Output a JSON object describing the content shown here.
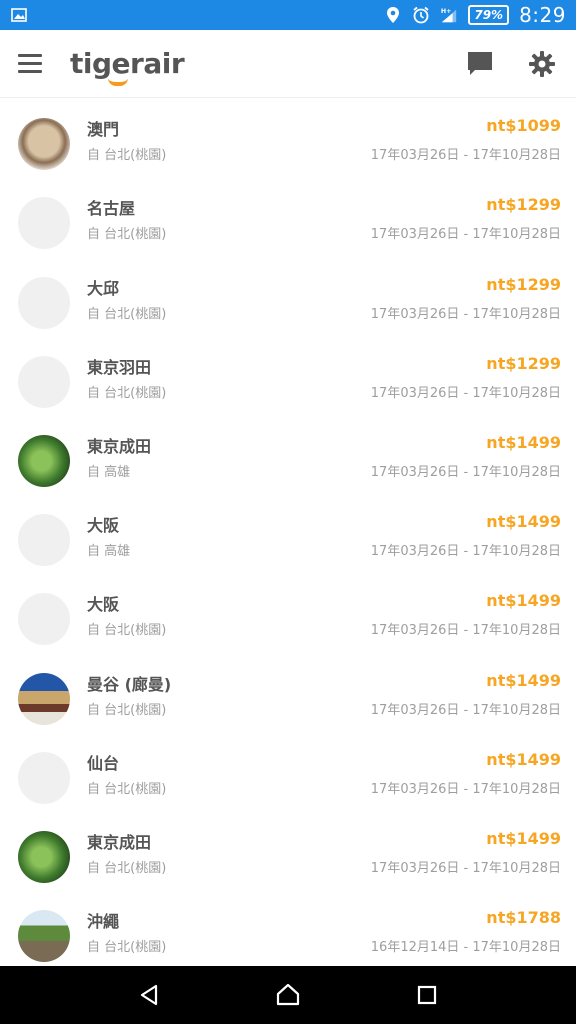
{
  "status_bar": {
    "battery_percent": "79%",
    "time": "8:29",
    "icons": [
      "image-icon",
      "location-icon",
      "alarm-icon",
      "signal-icon",
      "battery-icon"
    ]
  },
  "app_bar": {
    "logo_text": "tigerair",
    "icons": [
      "menu-icon",
      "chat-icon",
      "settings-icon"
    ]
  },
  "colors": {
    "status_bar": "#1e88e5",
    "price": "#f6a623",
    "primary_text": "#555555",
    "secondary_text": "#9e9e9e"
  },
  "flights": [
    {
      "destination": "",
      "origin": "自 高雄",
      "price": "",
      "dates": "17年03月26日 - 17年10月28日",
      "image": "photo"
    },
    {
      "destination": "澳門",
      "origin": "自 台北(桃園)",
      "price": "nt$1099",
      "dates": "17年03月26日 - 17年10月28日",
      "image": "macau"
    },
    {
      "destination": "名古屋",
      "origin": "自 台北(桃園)",
      "price": "nt$1299",
      "dates": "17年03月26日 - 17年10月28日",
      "image": ""
    },
    {
      "destination": "大邱",
      "origin": "自 台北(桃園)",
      "price": "nt$1299",
      "dates": "17年03月26日 - 17年10月28日",
      "image": ""
    },
    {
      "destination": "東京羽田",
      "origin": "自 台北(桃園)",
      "price": "nt$1299",
      "dates": "17年03月26日 - 17年10月28日",
      "image": ""
    },
    {
      "destination": "東京成田",
      "origin": "自 高雄",
      "price": "nt$1499",
      "dates": "17年03月26日 - 17年10月28日",
      "image": "narita"
    },
    {
      "destination": "大阪",
      "origin": "自 高雄",
      "price": "nt$1499",
      "dates": "17年03月26日 - 17年10月28日",
      "image": ""
    },
    {
      "destination": "大阪",
      "origin": "自 台北(桃園)",
      "price": "nt$1499",
      "dates": "17年03月26日 - 17年10月28日",
      "image": ""
    },
    {
      "destination": "曼谷 (廊曼)",
      "origin": "自 台北(桃園)",
      "price": "nt$1499",
      "dates": "17年03月26日 - 17年10月28日",
      "image": "bangkok"
    },
    {
      "destination": "仙台",
      "origin": "自 台北(桃園)",
      "price": "nt$1499",
      "dates": "17年03月26日 - 17年10月28日",
      "image": ""
    },
    {
      "destination": "東京成田",
      "origin": "自 台北(桃園)",
      "price": "nt$1499",
      "dates": "17年03月26日 - 17年10月28日",
      "image": "narita"
    },
    {
      "destination": "沖繩",
      "origin": "自 台北(桃園)",
      "price": "nt$1788",
      "dates": "16年12月14日 - 17年10月28日",
      "image": "okinawa"
    }
  ],
  "nav_bar": {
    "icons": [
      "back-icon",
      "home-icon",
      "recents-icon"
    ]
  }
}
